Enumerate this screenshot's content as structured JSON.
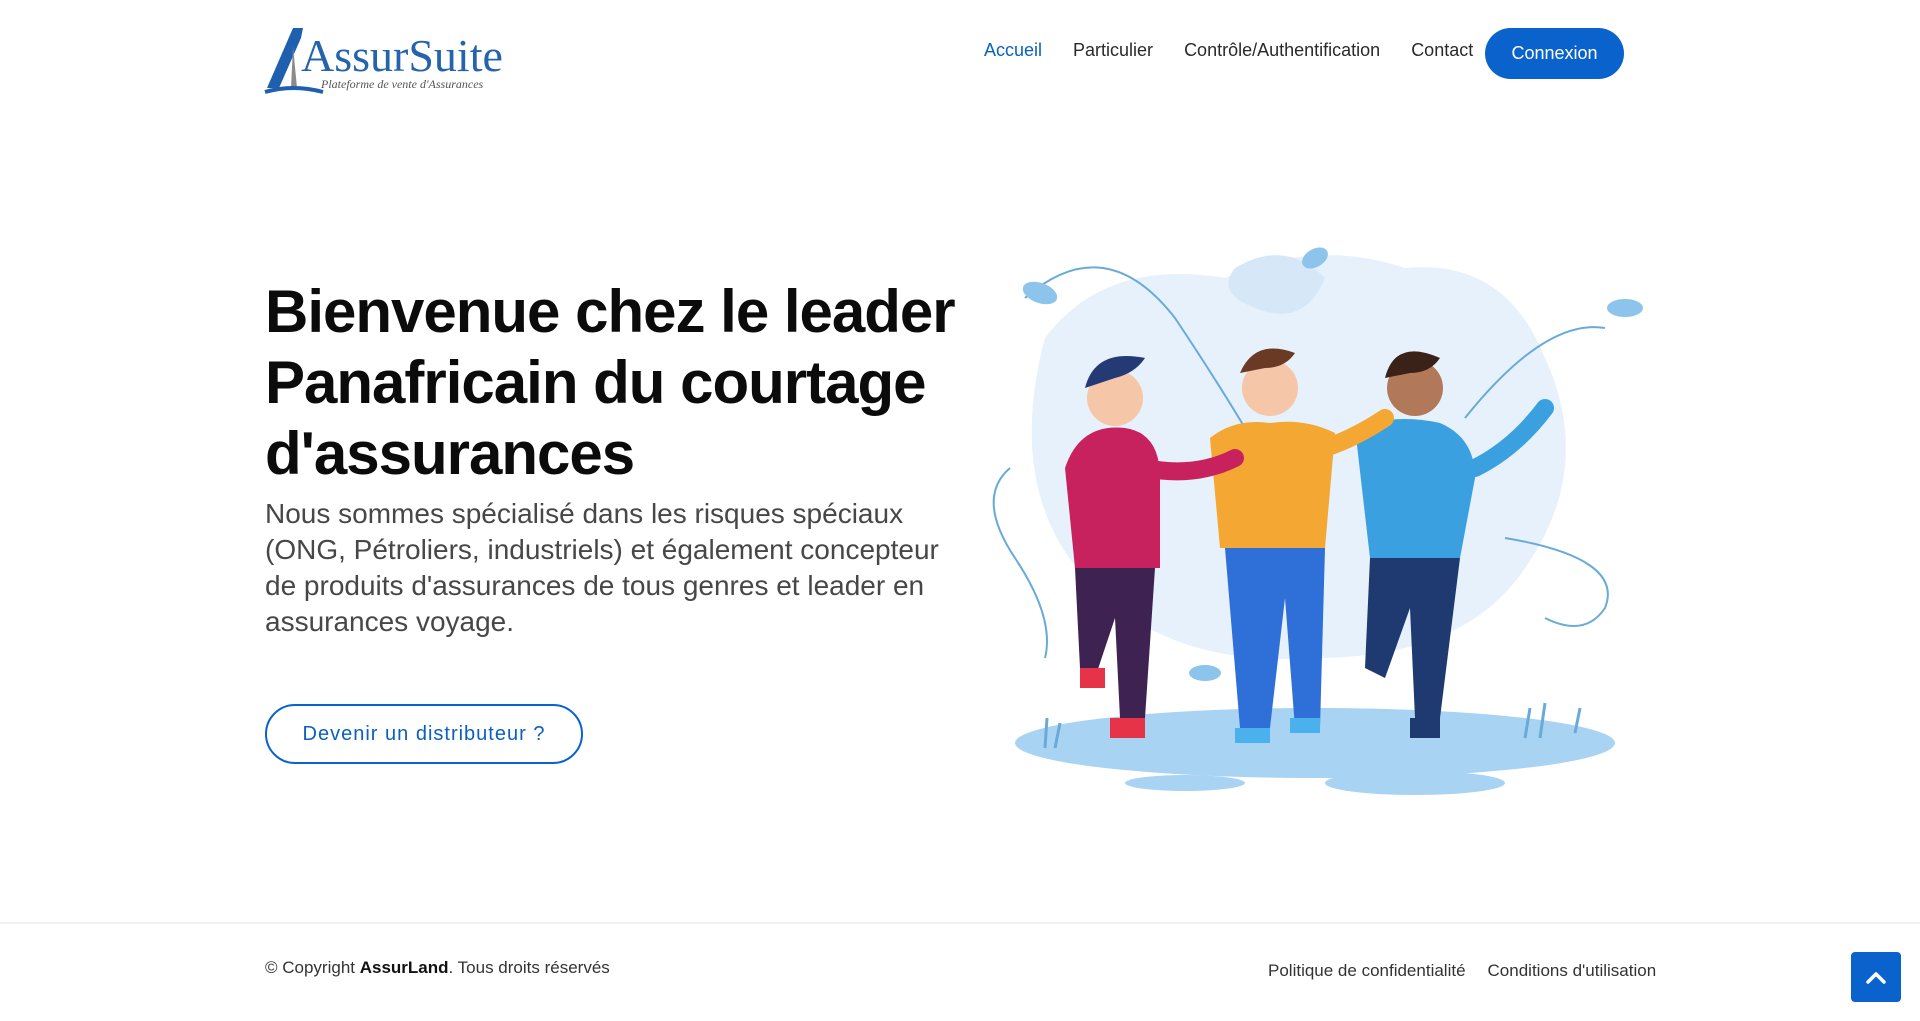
{
  "header": {
    "logo": {
      "name": "AssurSuite",
      "tagline": "Plateforme de vente d'Assurances",
      "icon": "logo-a-icon"
    },
    "nav": [
      {
        "label": "Accueil",
        "active": true
      },
      {
        "label": "Particulier",
        "active": false
      },
      {
        "label": "Contrôle/Authentification",
        "active": false
      },
      {
        "label": "Contact",
        "active": false
      }
    ],
    "login_label": "Connexion"
  },
  "hero": {
    "title": "Bienvenue chez le leader Panafricain du courtage d'assurances",
    "text": "Nous sommes spécialisé dans les risques spéciaux (ONG, Pétroliers, industriels) et également concepteur de produits d'assurances de tous genres et leader en assurances voyage.",
    "cta_label": "Devenir un distributeur ?",
    "illustration": "three-friends-illustration"
  },
  "footer": {
    "copyright_prefix": "© Copyright ",
    "copyright_brand": "AssurLand",
    "copyright_suffix": ". Tous droits réservés",
    "links": [
      "Politique de confidentialité",
      "Conditions d'utilisation"
    ],
    "back_to_top_icon": "chevron-up-icon"
  },
  "colors": {
    "accent": "#0a63cc",
    "link_active": "#0a5fbf",
    "title": "#0b0b0b",
    "text": "#474747"
  }
}
